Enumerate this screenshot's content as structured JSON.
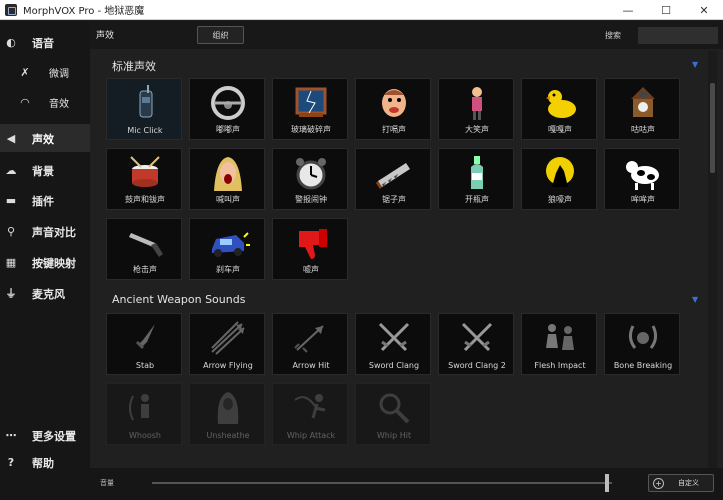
{
  "window": {
    "title": "MorphVOX Pro - 地狱恶魔",
    "controls": {
      "minimize": "—",
      "maximize": "☐",
      "close": "✕"
    }
  },
  "sidebar": {
    "items": [
      {
        "id": "voice",
        "label": "语音",
        "icon": "voice-icon",
        "glyph": "◐",
        "active": false,
        "sub": false
      },
      {
        "id": "tweak",
        "label": "微调",
        "icon": "tools-icon",
        "glyph": "✗",
        "active": false,
        "sub": true
      },
      {
        "id": "effects",
        "label": "音效",
        "icon": "lips-icon",
        "glyph": "◠",
        "active": false,
        "sub": true
      },
      {
        "id": "sound-effects",
        "label": "声效",
        "icon": "speaker-icon",
        "glyph": "◀",
        "active": true,
        "sub": false
      },
      {
        "id": "background",
        "label": "背景",
        "icon": "cloud-icon",
        "glyph": "☁",
        "active": false,
        "sub": false
      },
      {
        "id": "plugins",
        "label": "插件",
        "icon": "plug-icon",
        "glyph": "▬",
        "active": false,
        "sub": false
      },
      {
        "id": "voice-compare",
        "label": "声音对比",
        "icon": "magnifier-icon",
        "glyph": "⚲",
        "active": false,
        "sub": false
      },
      {
        "id": "hotkeys",
        "label": "按键映射",
        "icon": "keyboard-icon",
        "glyph": "▦",
        "active": false,
        "sub": false
      },
      {
        "id": "microphone",
        "label": "麦克风",
        "icon": "microphone-icon",
        "glyph": "⏚",
        "active": false,
        "sub": false
      },
      {
        "id": "more-settings",
        "label": "更多设置",
        "icon": "more-icon",
        "glyph": "⋯",
        "active": false,
        "sub": false
      },
      {
        "id": "help",
        "label": "帮助",
        "icon": "help-icon",
        "glyph": "?",
        "active": false,
        "sub": false
      }
    ]
  },
  "topbar": {
    "section_title": "声效",
    "organize_label": "组织",
    "search_label": "搜索",
    "search_value": ""
  },
  "groups": [
    {
      "title": "标准声效",
      "tiles": [
        {
          "label": "Mic Click",
          "icon": "walkie-talkie-icon",
          "selected": true
        },
        {
          "label": "嘟嘟声",
          "icon": "steering-wheel-icon"
        },
        {
          "label": "玻璃破碎声",
          "icon": "broken-window-icon"
        },
        {
          "label": "打嗝声",
          "icon": "burping-face-icon"
        },
        {
          "label": "大笑声",
          "icon": "laughing-man-icon"
        },
        {
          "label": "嘎嘎声",
          "icon": "rubber-duck-icon"
        },
        {
          "label": "咕咕声",
          "icon": "cuckoo-clock-icon"
        },
        {
          "label": "鼓声和钹声",
          "icon": "drum-icon"
        },
        {
          "label": "喊叫声",
          "icon": "screaming-woman-icon"
        },
        {
          "label": "警报闹钟",
          "icon": "alarm-clock-icon"
        },
        {
          "label": "锯子声",
          "icon": "saw-icon"
        },
        {
          "label": "开瓶声",
          "icon": "bottle-icon"
        },
        {
          "label": "狼嚎声",
          "icon": "howling-wolf-icon"
        },
        {
          "label": "哞哞声",
          "icon": "cow-icon"
        },
        {
          "label": "枪击声",
          "icon": "gun-icon"
        },
        {
          "label": "刹车声",
          "icon": "car-crash-icon"
        },
        {
          "label": "嘘声",
          "icon": "thumbs-down-icon"
        }
      ]
    },
    {
      "title": "Ancient Weapon Sounds",
      "tiles": [
        {
          "label": "Stab",
          "icon": "dagger-icon"
        },
        {
          "label": "Arrow Flying",
          "icon": "arrows-icon"
        },
        {
          "label": "Arrow Hit",
          "icon": "arrow-hit-icon"
        },
        {
          "label": "Sword Clang",
          "icon": "crossed-swords-icon"
        },
        {
          "label": "Sword Clang 2",
          "icon": "crossed-swords-icon"
        },
        {
          "label": "Flesh Impact",
          "icon": "fighters-icon"
        },
        {
          "label": "Bone Breaking",
          "icon": "bone-icon"
        },
        {
          "label": "Whoosh",
          "icon": "archer-icon",
          "dim": true
        },
        {
          "label": "Unsheathe",
          "icon": "hooded-figure-icon",
          "dim": true
        },
        {
          "label": "Whip Attack",
          "icon": "whip-icon",
          "dim": true
        },
        {
          "label": "Whip Hit",
          "icon": "whip-hit-icon",
          "dim": true
        }
      ]
    }
  ],
  "bottombar": {
    "volume_label": "音量",
    "volume_level": 0.99,
    "custom_label": "自定义"
  },
  "colors": {
    "accent": "#3a6fd8",
    "tile_bg": "#0c0c0c",
    "sidebar_bg": "#161616",
    "active_item": "#2b2b2b"
  }
}
